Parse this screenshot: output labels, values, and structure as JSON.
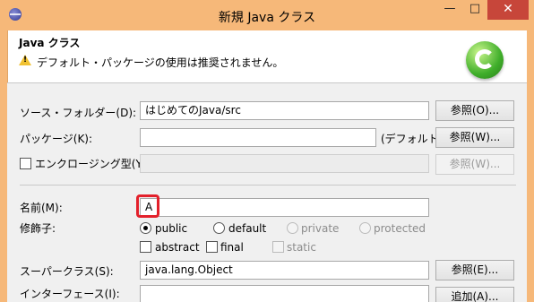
{
  "window": {
    "title": "新規 Java クラス",
    "minimize": "—",
    "maximize": "□",
    "close": "✕"
  },
  "header": {
    "title": "Java クラス",
    "warning": "デフォルト・パッケージの使用は推奨されません。"
  },
  "form": {
    "source_folder": {
      "label": "ソース・フォルダー(D):",
      "value": "はじめてのJava/src",
      "button": "参照(O)..."
    },
    "package": {
      "label": "パッケージ(K):",
      "value": "",
      "hint": "(デフォルト)",
      "button": "参照(W)..."
    },
    "enclosing": {
      "label": "エンクロージング型(Y):",
      "value": "",
      "button": "参照(W)..."
    },
    "name": {
      "label": "名前(M):",
      "value": "A"
    },
    "modifiers": {
      "label": "修飾子:",
      "public": "public",
      "default": "default",
      "private": "private",
      "protected": "protected",
      "abstract": "abstract",
      "final": "final",
      "static": "static"
    },
    "superclass": {
      "label": "スーパークラス(S):",
      "value": "java.lang.Object",
      "button": "参照(E)..."
    },
    "interfaces": {
      "label": "インターフェース(I):",
      "button": "追加(A)..."
    }
  }
}
